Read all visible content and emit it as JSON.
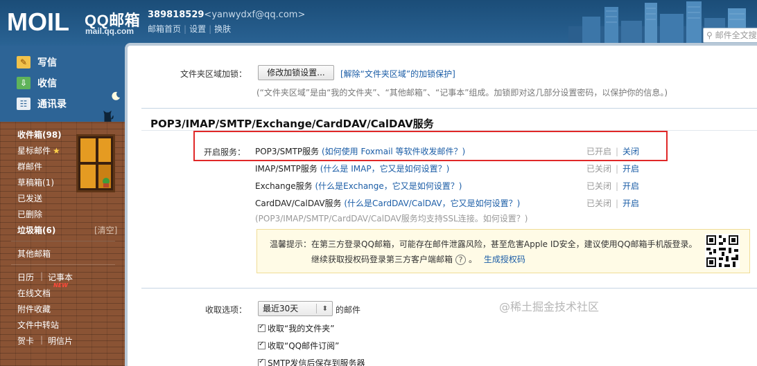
{
  "header": {
    "logo_text": "MOIL",
    "brand": "QQ邮箱",
    "domain": "mail.qq.com",
    "qq_number": "389818529",
    "email": "<yanwydxf@qq.com>",
    "links": [
      "邮箱首页",
      "设置",
      "换肤"
    ],
    "search_placeholder": "邮件全文搜"
  },
  "sidebar": {
    "actions": [
      {
        "label": "写信",
        "icon": "pencil-icon"
      },
      {
        "label": "收信",
        "icon": "inbox-download-icon"
      },
      {
        "label": "通讯录",
        "icon": "contacts-card-icon"
      }
    ],
    "folders": [
      {
        "label": "收件箱(98)",
        "bold": true
      },
      {
        "label": "星标邮件",
        "star": "★"
      },
      {
        "label": "群邮件"
      },
      {
        "label": "草稿箱(1)"
      },
      {
        "label": "已发送"
      },
      {
        "label": "已删除"
      },
      {
        "label": "垃圾箱(6)",
        "bold": true
      }
    ],
    "clear_label": "[清空]",
    "other_mailbox": "其他邮箱",
    "tools": {
      "calendar": "日历",
      "notes": "记事本",
      "online_docs": "在线文档",
      "new_badge": "NEW",
      "attachments": "附件收藏",
      "file_transfer": "文件中转站",
      "greeting_card": "贺卡",
      "postcard": "明信片"
    }
  },
  "main": {
    "folder_lock_label": "文件夹区域加锁：",
    "modify_lock_button": "修改加锁设置...",
    "unlock_link": "[解除“文件夹区域”的加锁保护]",
    "folder_note": "(“文件夹区域”是由“我的文件夹”、“其他邮箱”、“记事本”组成。加锁即对这几部分设置密码，以保护你的信息。)",
    "section_title": "POP3/IMAP/SMTP/Exchange/CardDAV/CalDAV服务",
    "enable_label": "开启服务：",
    "services": [
      {
        "name": "POP3/SMTP服务",
        "help": "(如何使用 Foxmail 等软件收发邮件？)",
        "status": "已开启",
        "action": "关闭"
      },
      {
        "name": "IMAP/SMTP服务",
        "help": "(什么是 IMAP，它又是如何设置？)",
        "status": "已关闭",
        "action": "开启"
      },
      {
        "name": "Exchange服务",
        "help": "(什么是Exchange，它又是如何设置？)",
        "status": "已关闭",
        "action": "开启"
      },
      {
        "name": "CardDAV/CalDAV服务",
        "help": "(什么是CardDAV/CalDAV，它又是如何设置？)",
        "status": "已关闭",
        "action": "开启"
      }
    ],
    "ssl_note": "(POP3/IMAP/SMTP/CardDAV/CalDAV服务均支持SSL连接。如何设置？)",
    "tip_line1": "温馨提示：在第三方登录QQ邮箱，可能存在邮件泄露风险，甚至危害Apple ID安全，建议使用QQ邮箱手机版登录。",
    "tip_line2": "继续获取授权码登录第三方客户端邮箱",
    "tip_help": "?",
    "tip_after": "。",
    "generate_code": "生成授权码",
    "receive_label": "收取选项：",
    "receive_select": "最近30天",
    "receive_suffix": "的邮件",
    "checkboxes": [
      "收取“我的文件夹”",
      "收取“QQ邮件订阅”",
      "SMTP发信后保存到服务器"
    ]
  },
  "watermark": "@稀土掘金技术社区",
  "colors": {
    "link": "#1a5ca6",
    "highlight_border": "#e02727",
    "header_bg": "#1b4d78",
    "brick": "#8a5334"
  }
}
